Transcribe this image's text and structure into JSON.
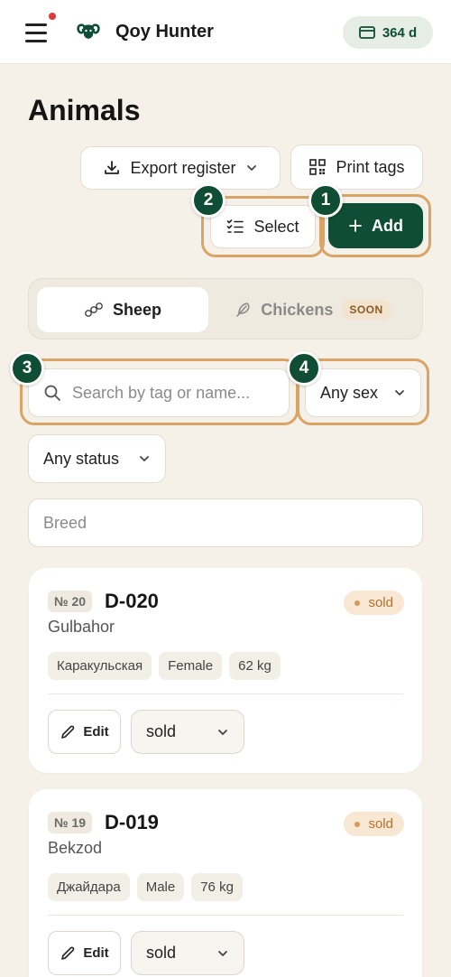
{
  "header": {
    "app_name": "Qoy Hunter",
    "days_badge": "364 d"
  },
  "page": {
    "title": "Animals"
  },
  "toolbar": {
    "export_label": "Export register",
    "print_label": "Print tags",
    "select_label": "Select",
    "add_label": "Add"
  },
  "badges": {
    "add": "1",
    "select": "2",
    "search": "3",
    "sex": "4"
  },
  "species_tabs": {
    "sheep": "Sheep",
    "chickens": "Chickens",
    "chickens_badge": "SOON"
  },
  "filters": {
    "search_placeholder": "Search by tag or name...",
    "sex_value": "Any sex",
    "status_value": "Any status",
    "breed_placeholder": "Breed"
  },
  "animals": [
    {
      "number": "№ 20",
      "tag": "D-020",
      "name": "Gulbahor",
      "status": "sold",
      "breed": "Каракульская",
      "sex": "Female",
      "weight": "62 kg",
      "edit_label": "Edit",
      "status_select": "sold"
    },
    {
      "number": "№ 19",
      "tag": "D-019",
      "name": "Bekzod",
      "status": "sold",
      "breed": "Джайдара",
      "sex": "Male",
      "weight": "76 kg",
      "edit_label": "Edit",
      "status_select": "sold"
    }
  ],
  "colors": {
    "brand": "#0f4d37",
    "highlight": "#d9a466",
    "background": "#f5f1e8",
    "sold": "#b5712d"
  }
}
